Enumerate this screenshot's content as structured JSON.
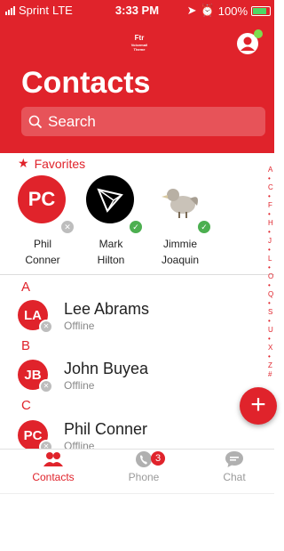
{
  "status_bar": {
    "carrier": "Sprint",
    "network": "LTE",
    "time": "3:33 PM",
    "battery": "100%"
  },
  "header": {
    "logo_text": "Ftr",
    "logo_sub": "Voicemail Theme",
    "title": "Contacts"
  },
  "search": {
    "placeholder": "Search"
  },
  "favorites": {
    "heading": "Favorites",
    "items": [
      {
        "initials": "PC",
        "first": "Phil",
        "last": "Conner",
        "status": "offline"
      },
      {
        "initials": "",
        "first": "Mark",
        "last": "Hilton",
        "status": "online"
      },
      {
        "initials": "",
        "first": "Jimmie",
        "last": "Joaquin",
        "status": "online"
      }
    ]
  },
  "sections": [
    {
      "letter": "A",
      "contacts": [
        {
          "initials": "LA",
          "name": "Lee Abrams",
          "status": "Offline"
        }
      ]
    },
    {
      "letter": "B",
      "contacts": [
        {
          "initials": "JB",
          "name": "John Buyea",
          "status": "Offline"
        }
      ]
    },
    {
      "letter": "C",
      "contacts": [
        {
          "initials": "PC",
          "name": "Phil Conner",
          "status": "Offline"
        }
      ]
    }
  ],
  "index_letters": [
    "A",
    "•",
    "C",
    "•",
    "F",
    "•",
    "H",
    "•",
    "J",
    "•",
    "L",
    "•",
    "O",
    "•",
    "Q",
    "•",
    "S",
    "•",
    "U",
    "•",
    "X",
    "•",
    "Z",
    "#"
  ],
  "tabs": [
    {
      "label": "Contacts",
      "active": true
    },
    {
      "label": "Phone",
      "badge": "3"
    },
    {
      "label": "Chat"
    }
  ],
  "colors": {
    "brand": "#e0232b",
    "online": "#4caf50",
    "offline": "#bdbdbd"
  }
}
